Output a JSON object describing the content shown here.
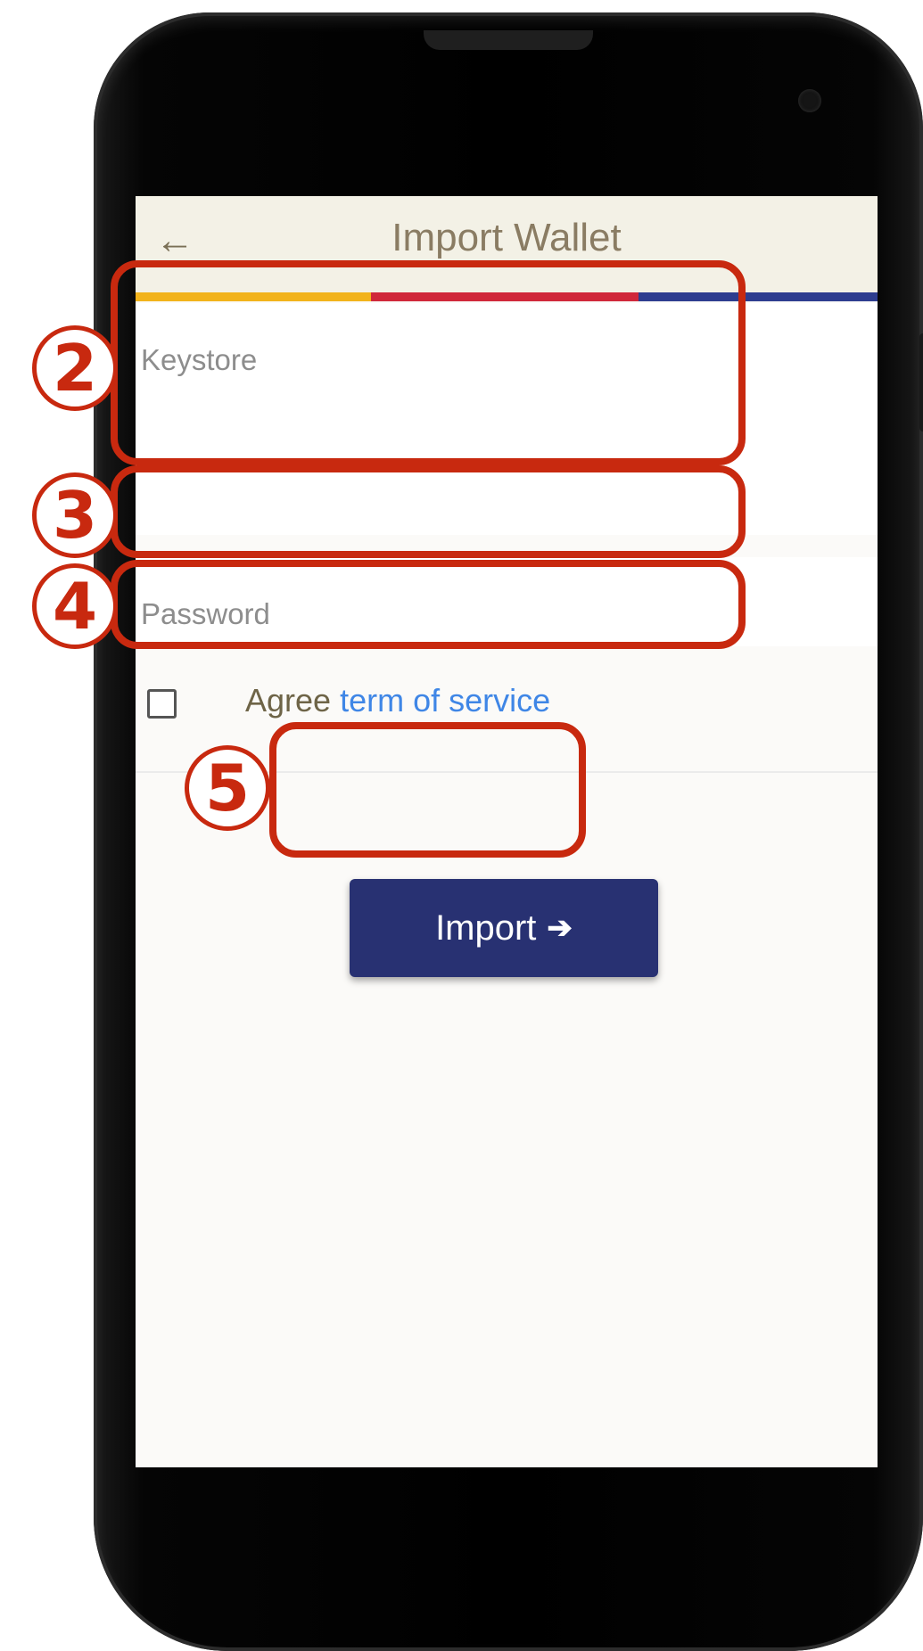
{
  "header": {
    "back_icon": "back-arrow-icon",
    "back_glyph": "←",
    "title": "Import Wallet"
  },
  "colors": {
    "stripe": [
      "#f2b31b",
      "#d0283a",
      "#2e3d8f"
    ],
    "highlight": "#c8290f",
    "button": "#283172",
    "link": "#3f86e6"
  },
  "form": {
    "keystore_placeholder": "Keystore",
    "password_placeholder": "Password",
    "agree_text": "Agree",
    "agree_link": "term of service",
    "agree_checked": false
  },
  "actions": {
    "import_label": "Import",
    "import_arrow": "➔"
  },
  "annotations": [
    "2",
    "3",
    "4",
    "5"
  ]
}
